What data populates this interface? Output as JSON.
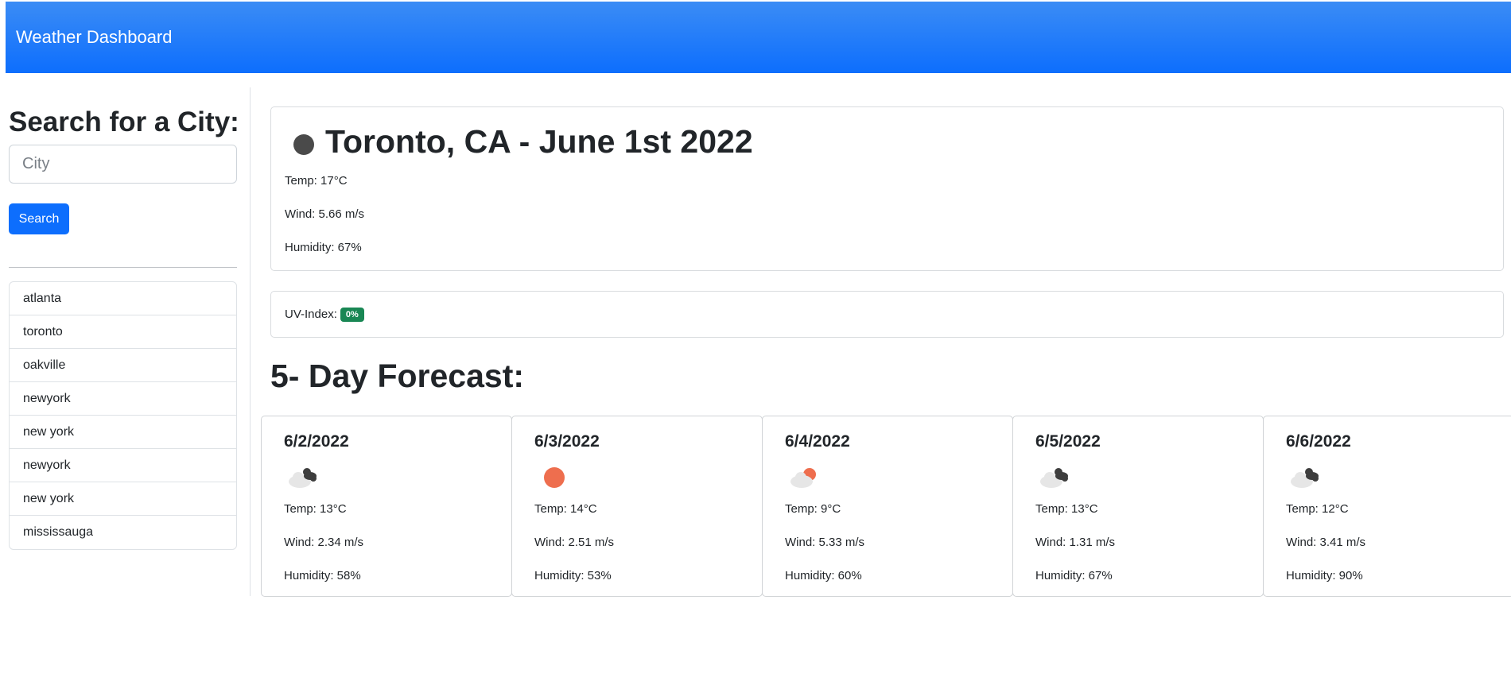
{
  "navbar": {
    "brand": "Weather Dashboard"
  },
  "sidebar": {
    "title": "Search for a City:",
    "input": {
      "placeholder": "City",
      "value": ""
    },
    "search_button": "Search",
    "history": [
      "atlanta",
      "toronto",
      "oakville",
      "newyork",
      "new york",
      "newyork",
      "new york",
      "mississauga"
    ]
  },
  "current": {
    "title": "Toronto, CA - June 1st 2022",
    "icon": "moon-icon",
    "temp": "Temp: 17°C",
    "wind": "Wind: 5.66 m/s",
    "humidity": "Humidity: 67%",
    "uv_label": "UV-Index:",
    "uv_value": "0%"
  },
  "forecast": {
    "title": "5- Day Forecast:",
    "days": [
      {
        "date": "6/2/2022",
        "icon": "broken-clouds-icon",
        "temp": "Temp: 13°C",
        "wind": "Wind: 2.34 m/s",
        "humidity": "Humidity: 58%"
      },
      {
        "date": "6/3/2022",
        "icon": "clear-sun-icon",
        "temp": "Temp: 14°C",
        "wind": "Wind: 2.51 m/s",
        "humidity": "Humidity: 53%"
      },
      {
        "date": "6/4/2022",
        "icon": "partly-cloudy-icon",
        "temp": "Temp: 9°C",
        "wind": "Wind: 5.33 m/s",
        "humidity": "Humidity: 60%"
      },
      {
        "date": "6/5/2022",
        "icon": "broken-clouds-icon",
        "temp": "Temp: 13°C",
        "wind": "Wind: 1.31 m/s",
        "humidity": "Humidity: 67%"
      },
      {
        "date": "6/6/2022",
        "icon": "broken-clouds-icon",
        "temp": "Temp: 12°C",
        "wind": "Wind: 3.41 m/s",
        "humidity": "Humidity: 90%"
      }
    ]
  },
  "colors": {
    "navbar": "#0d6efd",
    "primary_button": "#0d6efd",
    "uv_badge": "#198754",
    "sun": "#ee6e4e",
    "cloud": "#e6e6e6",
    "dark_cloud": "#3d3d3d"
  }
}
